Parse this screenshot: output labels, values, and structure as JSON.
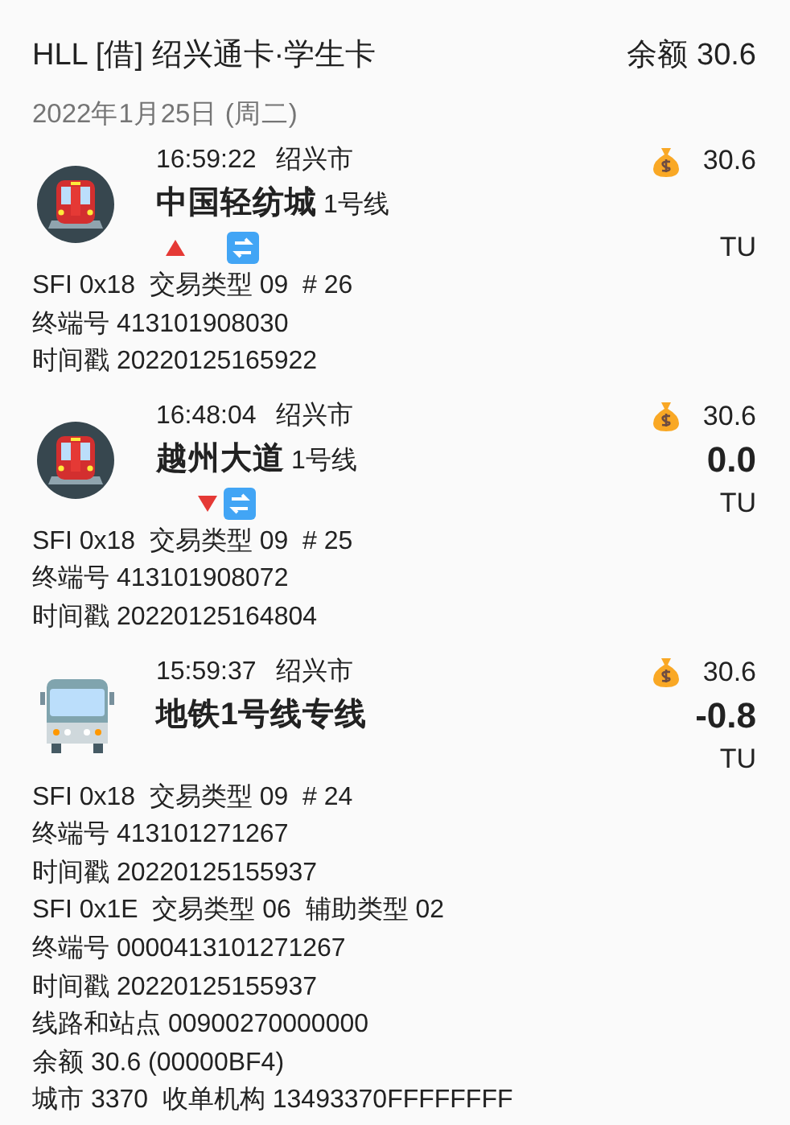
{
  "header": {
    "title": "HLL [借] 绍兴通卡·学生卡",
    "balance": "余额 30.6"
  },
  "date": "2022年1月25日 (周二)",
  "records": [
    {
      "kind": "metro",
      "time": "16:59:22",
      "city": "绍兴市",
      "station": "中国轻纺城",
      "line": "1号线",
      "tap_in": true,
      "balance": "30.6",
      "unit": "TU",
      "details": [
        "SFI 0x18  交易类型 09  # 26",
        "终端号 413101908030",
        "时间戳 20220125165922"
      ]
    },
    {
      "kind": "metro",
      "time": "16:48:04",
      "city": "绍兴市",
      "station": "越州大道",
      "line": "1号线",
      "tap_in": false,
      "balance": "30.6",
      "amount": "0.0",
      "unit": "TU",
      "details": [
        "SFI 0x18  交易类型 09  # 25",
        "终端号 413101908072",
        "时间戳 20220125164804"
      ]
    },
    {
      "kind": "bus",
      "time": "15:59:37",
      "city": "绍兴市",
      "station": "地铁1号线专线",
      "balance": "30.6",
      "amount": "-0.8",
      "unit": "TU",
      "details": [
        "SFI 0x18  交易类型 09  # 24",
        "终端号 413101271267",
        "时间戳 20220125155937",
        "SFI 0x1E  交易类型 06  辅助类型 02",
        "终端号 0000413101271267",
        "时间戳 20220125155937",
        "线路和站点 00900270000000",
        "余额 30.6 (00000BF4)",
        "城市 3370  收单机构 13493370FFFFFFFF"
      ]
    }
  ]
}
